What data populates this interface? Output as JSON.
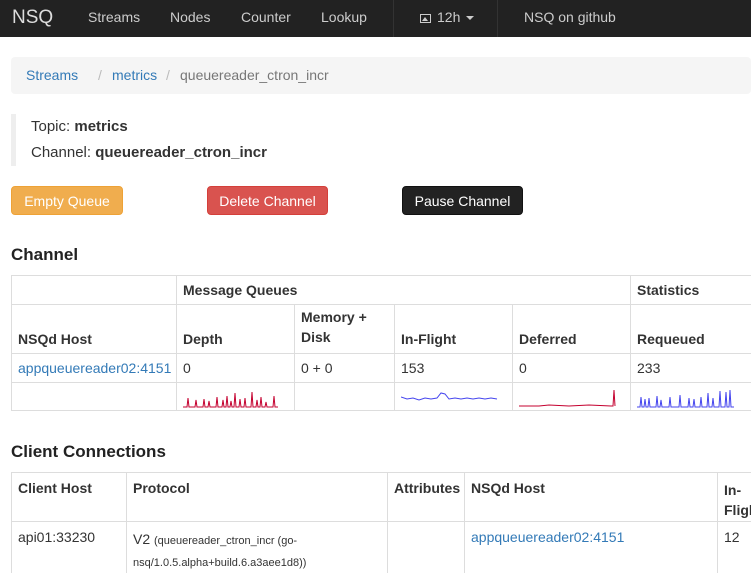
{
  "navbar": {
    "brand": "NSQ",
    "links": [
      "Streams",
      "Nodes",
      "Counter",
      "Lookup"
    ],
    "timeframe": "12h",
    "github": "NSQ on github"
  },
  "breadcrumb": {
    "items": [
      "Streams",
      "metrics",
      "queuereader_ctron_incr"
    ]
  },
  "info": {
    "topic_label": "Topic:",
    "topic": "metrics",
    "channel_label": "Channel:",
    "channel": "queuereader_ctron_incr"
  },
  "buttons": {
    "empty": "Empty Queue",
    "delete": "Delete Channel",
    "pause": "Pause Channel"
  },
  "channel_section": {
    "title": "Channel",
    "group_headers": [
      "Message Queues",
      "Statistics"
    ],
    "headers": {
      "host": "NSQd Host",
      "depth": "Depth",
      "memdisk_1": "Memory +",
      "memdisk_2": "Disk",
      "inflight": "In-Flight",
      "deferred": "Deferred",
      "requeued": "Requeued"
    },
    "row": {
      "host": "appqueuereader02:4151",
      "depth": "0",
      "memdisk": "0 + 0",
      "inflight": "153",
      "deferred": "0",
      "requeued": "233"
    },
    "spark_colors": {
      "depth": "#c4002f",
      "inflight": "#4444ee",
      "deferred": "#c4002f",
      "requeued": "#4444ee"
    }
  },
  "clients_section": {
    "title": "Client Connections",
    "headers": {
      "client_host": "Client Host",
      "protocol": "Protocol",
      "attributes": "Attributes",
      "nsqd_host": "NSQd Host",
      "inflight_1": "In-",
      "inflight_2": "Fligh"
    },
    "row": {
      "client_host": "api01:33230",
      "protocol_main": "V2",
      "protocol_detail_1": "(queuereader_ctron_incr (go-",
      "protocol_detail_2": "nsq/1.0.5.alpha+build.6.a3aee1d8))",
      "attributes": "",
      "nsqd_host": "appqueuereader02:4151",
      "inflight": "12"
    }
  }
}
